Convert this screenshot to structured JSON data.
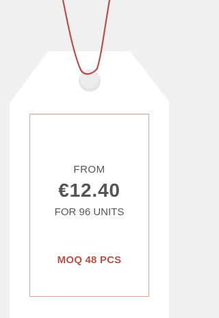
{
  "tag": {
    "from_label": "FROM",
    "price": "€12.40",
    "units_label": "FOR 96 UNITS",
    "moq_label": "MOQ 48 PCS"
  },
  "colors": {
    "background": "#f0f0f0",
    "tag_fill": "#ffffff",
    "string": "#b5504a",
    "border": "#d9a49a",
    "text": "#555555",
    "accent": "#b5504a"
  }
}
